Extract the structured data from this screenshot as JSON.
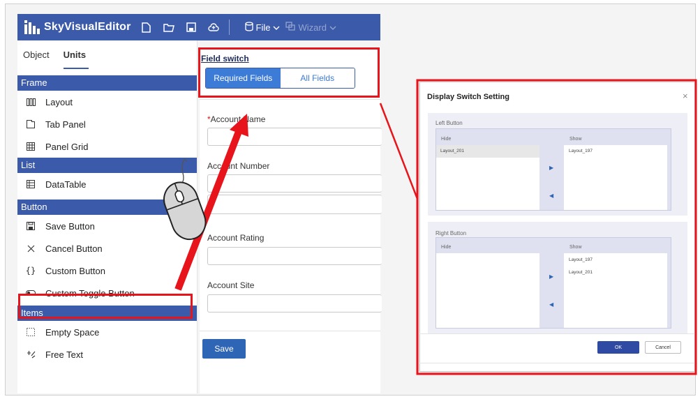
{
  "app": {
    "title": "SkyVisualEditor",
    "menu": [
      {
        "label": "File",
        "dim": false
      },
      {
        "label": "Wizard",
        "dim": true
      }
    ]
  },
  "left_panel": {
    "tabs": [
      {
        "label": "Object",
        "active": false
      },
      {
        "label": "Units",
        "active": true
      }
    ],
    "sections": [
      {
        "title": "Frame",
        "items": [
          {
            "label": "Layout",
            "icon": "layout-columns-icon"
          },
          {
            "label": "Tab Panel",
            "icon": "tab-panel-icon"
          },
          {
            "label": "Panel Grid",
            "icon": "grid-icon"
          }
        ]
      },
      {
        "title": "List",
        "items": [
          {
            "label": "DataTable",
            "icon": "table-icon"
          }
        ]
      },
      {
        "title": "Button",
        "items": [
          {
            "label": "Save Button",
            "icon": "floppy-disk-icon"
          },
          {
            "label": "Cancel Button",
            "icon": "x-icon"
          },
          {
            "label": "Custom Button",
            "icon": "braces-icon"
          },
          {
            "label": "Custom Toggle Button",
            "icon": "toggle-icon"
          }
        ]
      },
      {
        "title": "Items",
        "items": [
          {
            "label": "Empty Space",
            "icon": "dotted-square-icon"
          },
          {
            "label": "Free Text",
            "icon": "free-text-icon"
          }
        ]
      }
    ]
  },
  "form": {
    "field_switch_title": "Field switch",
    "segments": [
      {
        "label": "Required Fields",
        "active": true
      },
      {
        "label": "All Fields",
        "active": false
      }
    ],
    "fields": [
      {
        "label": "Account Name",
        "required": true
      },
      {
        "label": "Account Number",
        "required": false
      },
      {
        "label": "Account Rating",
        "required": false
      },
      {
        "label": "Account Site",
        "required": false
      }
    ],
    "save_label": "Save"
  },
  "dialog": {
    "title": "Display Switch Setting",
    "close_glyph": "×",
    "left_button": {
      "title": "Left Button",
      "hide_header": "Hide",
      "show_header": "Show",
      "hide_items": [
        "Layout_201"
      ],
      "show_items": [
        "Layout_197"
      ]
    },
    "right_button": {
      "title": "Right Button",
      "hide_header": "Hide",
      "show_header": "Show",
      "hide_items": [],
      "show_items": [
        "Layout_197",
        "Layout_201"
      ]
    },
    "ok_label": "OK",
    "cancel_label": "Cancel"
  },
  "colors": {
    "brand": "#3c5aaa",
    "highlight": "#e8141b",
    "accent": "#3c7bd6"
  }
}
